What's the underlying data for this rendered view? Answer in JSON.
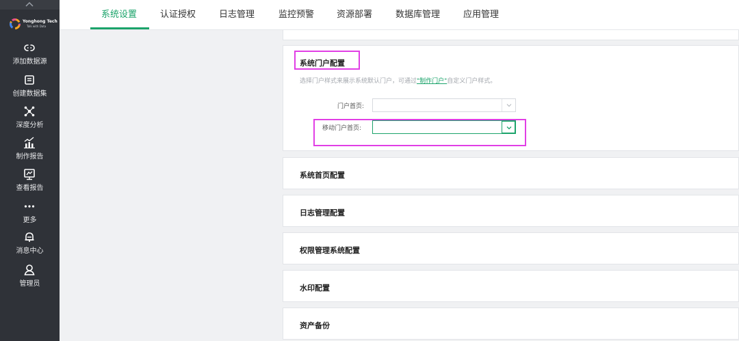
{
  "sidebar": {
    "logo": {
      "brand": "Yonghong Tech",
      "tagline": "Talk with Data"
    },
    "items": [
      {
        "label": "添加数据源",
        "icon": "link-icon"
      },
      {
        "label": "创建数据集",
        "icon": "dataset-icon"
      },
      {
        "label": "深度分析",
        "icon": "analysis-icon"
      },
      {
        "label": "制作报告",
        "icon": "chart-report-icon"
      },
      {
        "label": "查看报告",
        "icon": "view-report-icon"
      },
      {
        "label": "更多",
        "icon": "more-icon"
      },
      {
        "label": "消息中心",
        "icon": "bell-icon"
      },
      {
        "label": "管理员",
        "icon": "admin-user-icon"
      }
    ]
  },
  "topnav": {
    "tabs": [
      {
        "label": "系统设置",
        "active": true
      },
      {
        "label": "认证授权",
        "active": false
      },
      {
        "label": "日志管理",
        "active": false
      },
      {
        "label": "监控预警",
        "active": false
      },
      {
        "label": "资源部署",
        "active": false
      },
      {
        "label": "数据库管理",
        "active": false
      },
      {
        "label": "应用管理",
        "active": false
      }
    ]
  },
  "portal": {
    "title": "系统门户配置",
    "desc_before": "选择门户样式来展示系统默认门户，可通过",
    "desc_link": "\"制作门户\"",
    "desc_after": "自定义门户样式。",
    "home_label": "门户首页:",
    "home_value": "",
    "mobile_label": "移动门户首页:",
    "mobile_value": ""
  },
  "sections": [
    {
      "title": "系统首页配置"
    },
    {
      "title": "日志管理配置"
    },
    {
      "title": "权限管理系统配置"
    },
    {
      "title": "水印配置"
    },
    {
      "title": "资产备份"
    }
  ],
  "colors": {
    "accent": "#1aa36a",
    "highlight": "#e13ee5",
    "sidebar_bg": "#2f3238"
  }
}
